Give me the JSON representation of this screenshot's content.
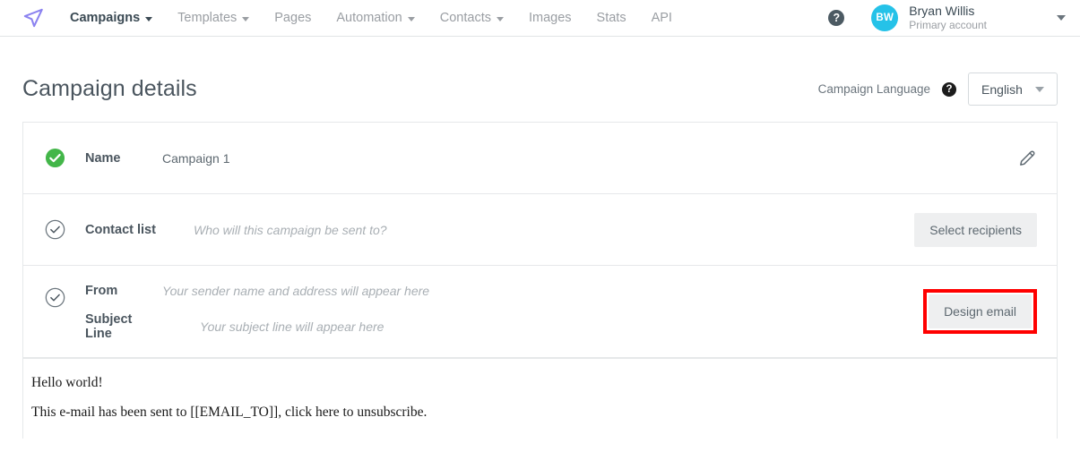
{
  "navbar": {
    "logo_icon": "paper-plane-icon",
    "items": [
      {
        "label": "Campaigns",
        "has_caret": true,
        "active": true
      },
      {
        "label": "Templates",
        "has_caret": true,
        "active": false
      },
      {
        "label": "Pages",
        "has_caret": false,
        "active": false
      },
      {
        "label": "Automation",
        "has_caret": true,
        "active": false
      },
      {
        "label": "Contacts",
        "has_caret": true,
        "active": false
      },
      {
        "label": "Images",
        "has_caret": false,
        "active": false
      },
      {
        "label": "Stats",
        "has_caret": false,
        "active": false
      },
      {
        "label": "API",
        "has_caret": false,
        "active": false
      }
    ],
    "help_icon": "question-mark-icon",
    "help_glyph": "?",
    "account": {
      "avatar_initials": "BW",
      "avatar_color": "#25c2e8",
      "name": "Bryan Willis",
      "subtitle": "Primary account"
    }
  },
  "header": {
    "title": "Campaign details",
    "language_label": "Campaign Language",
    "language_help_glyph": "?",
    "language_value": "English"
  },
  "rows": {
    "name": {
      "status_icon": "check-circle-filled-icon",
      "label": "Name",
      "value": "Campaign 1",
      "edit_icon": "pencil-icon"
    },
    "contact_list": {
      "status_icon": "check-circle-outline-icon",
      "label": "Contact list",
      "placeholder": "Who will this campaign be sent to?",
      "action_label": "Select recipients"
    },
    "from": {
      "status_icon": "check-circle-outline-icon",
      "label": "From",
      "placeholder": "Your sender name and address will appear here",
      "subject_label": "Subject Line",
      "subject_placeholder": "Your subject line will appear here",
      "action_label": "Design email",
      "highlight_color": "#ff0000"
    }
  },
  "preview": {
    "line1": "Hello world!",
    "line2": "This e-mail has been sent to [[EMAIL_TO]], click here to unsubscribe."
  },
  "colors": {
    "status_complete": "#43b649",
    "accent_logo": "#8b82f0",
    "text_primary": "#4a555e",
    "text_muted": "#9a9ea3"
  }
}
